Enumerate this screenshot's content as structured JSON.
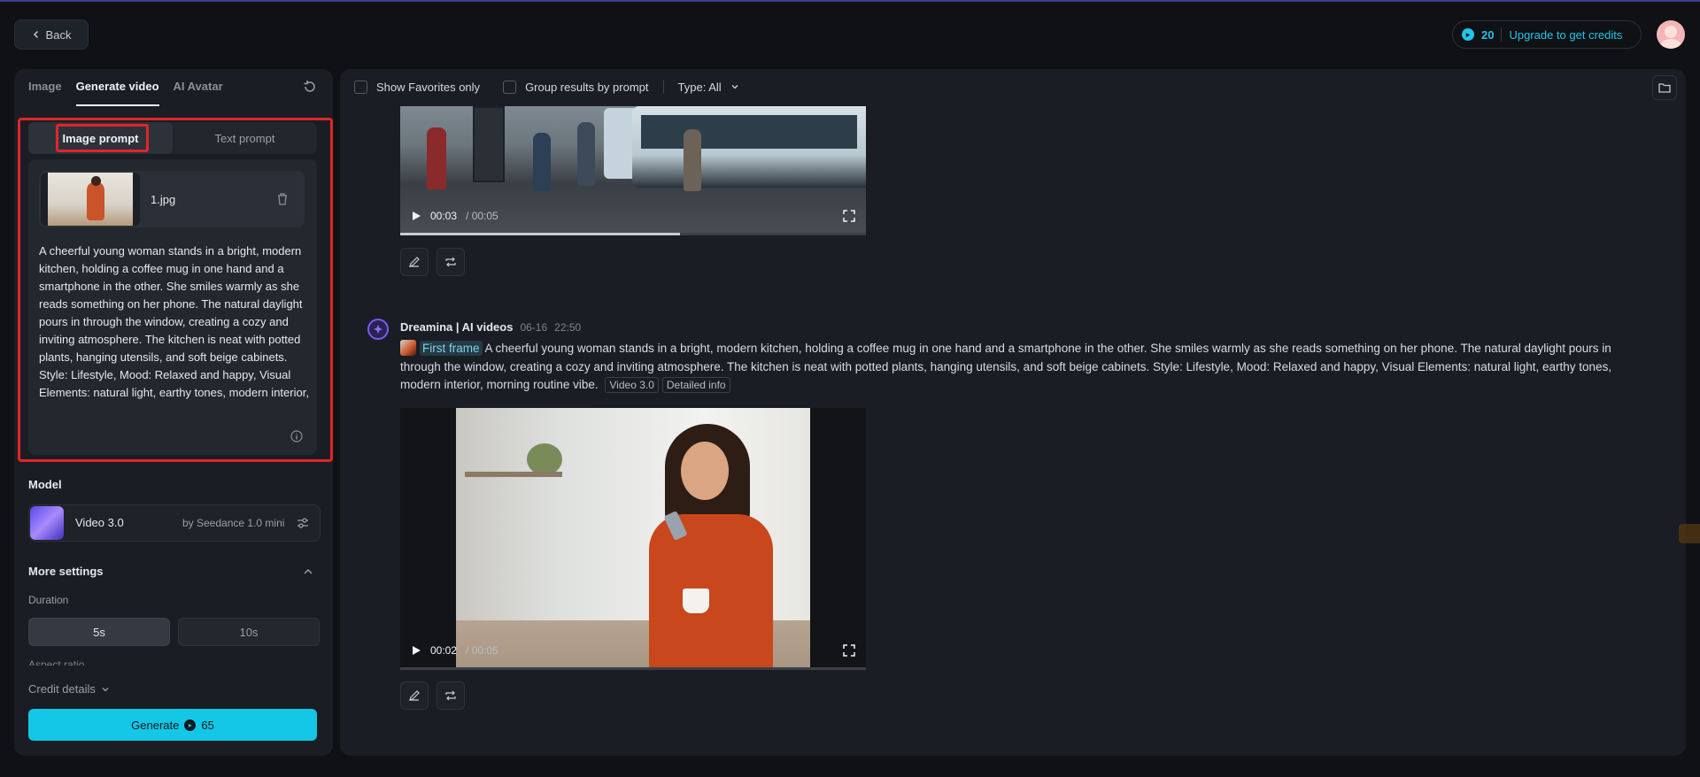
{
  "header": {
    "back_label": "Back",
    "credits_count": "20",
    "upgrade_label": "Upgrade to get credits"
  },
  "left_panel": {
    "tabs": [
      {
        "label": "Image",
        "active": false
      },
      {
        "label": "Generate video",
        "active": true
      },
      {
        "label": "AI Avatar",
        "active": false
      }
    ],
    "prompt_modes": {
      "image": "Image prompt",
      "text": "Text prompt",
      "active": "image"
    },
    "file": {
      "name": "1.jpg"
    },
    "prompt_text": "A cheerful young woman stands in a bright, modern kitchen, holding a coffee mug in one hand and a smartphone in the other. She smiles warmly as she reads something on her phone. The natural daylight pours in through the window, creating a cozy and inviting atmosphere. The kitchen is neat with potted plants, hanging utensils, and soft beige cabinets. Style: Lifestyle, Mood: Relaxed and happy, Visual Elements: natural light, earthy tones, modern interior,",
    "model": {
      "section_label": "Model",
      "name": "Video 3.0",
      "by": "by Seedance 1.0 mini"
    },
    "more_settings": {
      "label": "More settings",
      "duration_label": "Duration",
      "durations": [
        "5s",
        "10s"
      ],
      "selected_duration": "5s",
      "aspect_label": "Aspect ratio"
    },
    "credit_details_label": "Credit details",
    "generate": {
      "label": "Generate",
      "cost": "65"
    }
  },
  "results": {
    "toolbar": {
      "show_favorites_label": "Show Favorites only",
      "group_label": "Group results by prompt",
      "type_label": "Type: All"
    },
    "video1": {
      "current": "00:03",
      "total": "/ 00:05",
      "progress": 0.6
    },
    "entry": {
      "author": "Dreamina | AI videos",
      "date": "06-16",
      "time": "22:50",
      "first_frame_label": "First frame",
      "prompt": "A cheerful young woman stands in a bright, modern kitchen, holding a coffee mug in one hand and a smartphone in the other. She smiles warmly as she reads something on her phone. The natural daylight pours in through the window, creating a cozy and inviting atmosphere. The kitchen is neat with potted plants, hanging utensils, and soft beige cabinets. Style: Lifestyle, Mood: Relaxed and happy, Visual Elements: natural light, earthy tones, modern interior, morning routine vibe.",
      "model_chip": "Video 3.0",
      "detail_chip": "Detailed info"
    },
    "video2": {
      "current": "00:02",
      "total": "/ 00:05",
      "progress": 0.0
    }
  },
  "colors": {
    "accent": "#14c7e6",
    "highlight_box": "#e1252a",
    "background": "#0f1115",
    "panel": "#1a1d23"
  }
}
